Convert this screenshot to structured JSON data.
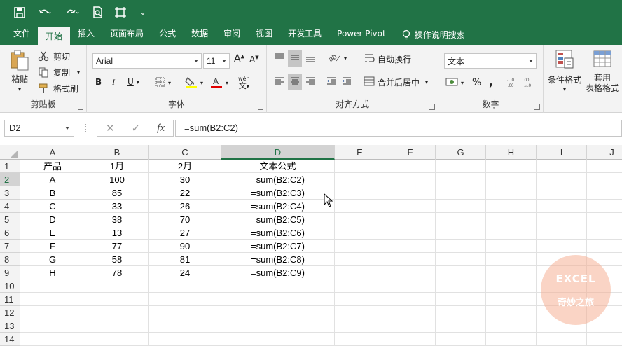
{
  "qat": {
    "dropdown": "⌄"
  },
  "tabs": [
    "文件",
    "开始",
    "插入",
    "页面布局",
    "公式",
    "数据",
    "审阅",
    "视图",
    "开发工具",
    "Power Pivot"
  ],
  "active_tab": "开始",
  "tell_me": "操作说明搜索",
  "clipboard": {
    "paste": "粘贴",
    "cut": "剪切",
    "copy": "复制",
    "painter": "格式刷",
    "label": "剪贴板"
  },
  "font": {
    "name": "Arial",
    "size": "11",
    "bold": "B",
    "italic": "I",
    "underline": "U",
    "label": "字体",
    "phonetic": "wén"
  },
  "alignment": {
    "wrap": "自动换行",
    "merge": "合并后居中",
    "label": "对齐方式"
  },
  "number": {
    "format": "文本",
    "percent": "%",
    "comma": ",",
    "label": "数字"
  },
  "styles": {
    "conditional": "条件格式",
    "table_line1": "套用",
    "table_line2": "表格格式"
  },
  "formula_bar": {
    "name_box": "D2",
    "formula": "=sum(B2:C2)",
    "fx": "fx"
  },
  "columns": [
    "A",
    "B",
    "C",
    "D",
    "E",
    "F",
    "G",
    "H",
    "I",
    "J"
  ],
  "rows": [
    "1",
    "2",
    "3",
    "4",
    "5",
    "6",
    "7",
    "8",
    "9",
    "10",
    "11",
    "12",
    "13",
    "14"
  ],
  "table": [
    [
      "产品",
      "1月",
      "2月",
      "文本公式"
    ],
    [
      "A",
      "100",
      "30",
      "=sum(B2:C2)"
    ],
    [
      "B",
      "85",
      "22",
      "=sum(B2:C3)"
    ],
    [
      "C",
      "33",
      "26",
      "=sum(B2:C4)"
    ],
    [
      "D",
      "38",
      "70",
      "=sum(B2:C5)"
    ],
    [
      "E",
      "13",
      "27",
      "=sum(B2:C6)"
    ],
    [
      "F",
      "77",
      "90",
      "=sum(B2:C7)"
    ],
    [
      "G",
      "58",
      "81",
      "=sum(B2:C8)"
    ],
    [
      "H",
      "78",
      "24",
      "=sum(B2:C9)"
    ]
  ],
  "watermark": {
    "line1": "EXCEL",
    "line2": "奇妙之旅"
  },
  "colors": {
    "accent": "#217346"
  }
}
